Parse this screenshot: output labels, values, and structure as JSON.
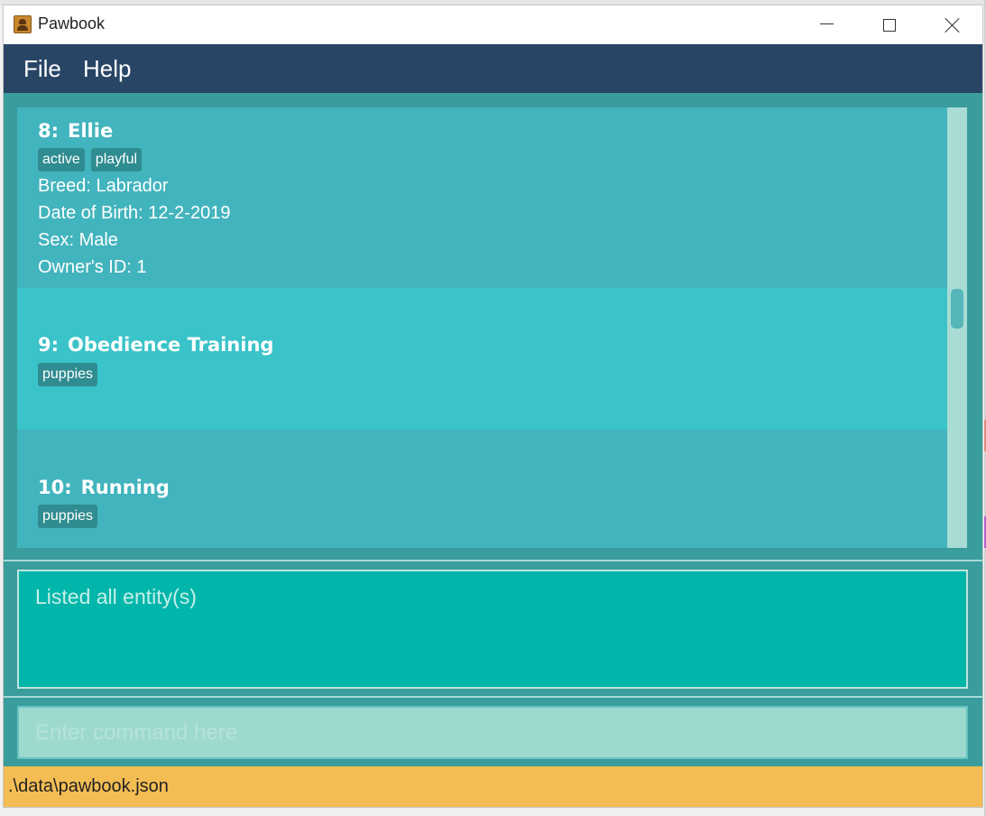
{
  "window": {
    "title": "Pawbook",
    "icon": "contact-book-icon"
  },
  "menu": {
    "file_label": "File",
    "help_label": "Help"
  },
  "list": {
    "items": [
      {
        "index": "8:",
        "name": "Ellie",
        "tags": [
          "active",
          "playful"
        ],
        "details": [
          "Breed: Labrador",
          "Date of Birth: 12-2-2019",
          "Sex: Male",
          "Owner's ID: 1"
        ]
      },
      {
        "index": "9:",
        "name": "Obedience Training",
        "tags": [
          "puppies"
        ]
      },
      {
        "index": "10:",
        "name": "Running",
        "tags": [
          "puppies"
        ]
      }
    ]
  },
  "result": {
    "message": "Listed all entity(s)"
  },
  "command": {
    "placeholder": "Enter command here",
    "value": ""
  },
  "status": {
    "file_path": ".\\data\\pawbook.json"
  },
  "colors": {
    "menubar": "#284565",
    "list_card": "#42b4bd",
    "list_card_alt": "#3ac3c8",
    "tag": "#2f8c90",
    "result_box": "#00b6aa",
    "command_box": "#9ed9d0",
    "statusbar": "#f4bd54"
  }
}
